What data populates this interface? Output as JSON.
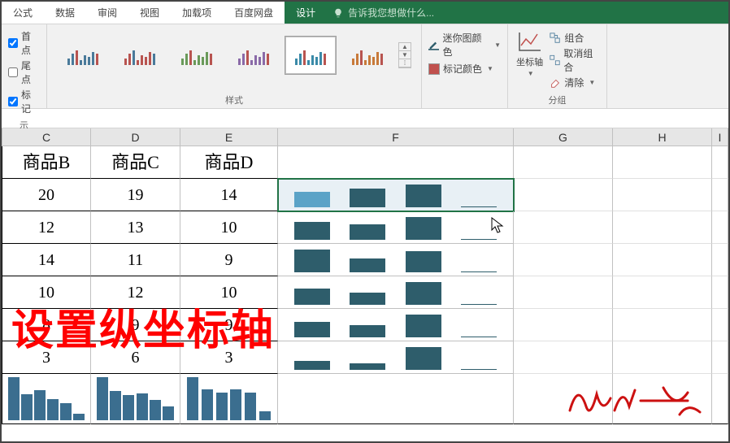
{
  "ribbon": {
    "tabs": [
      "公式",
      "数据",
      "审阅",
      "视图",
      "加载项",
      "百度网盘",
      "设计"
    ],
    "active_tab": "设计",
    "tell_me": "告诉我您想做什么...",
    "show": {
      "first": "首点",
      "last": "尾点",
      "markers": "标记",
      "first_checked": true,
      "last_checked": false,
      "markers_checked": true
    },
    "style_group_label": "样式",
    "color": {
      "sparkline": "迷你图颜色",
      "marker": "标记颜色"
    },
    "axis_label": "坐标轴",
    "group": {
      "group": "组合",
      "ungroup": "取消组合",
      "clear": "清除",
      "group_label": "分组"
    }
  },
  "columns": [
    "C",
    "D",
    "E",
    "F",
    "G",
    "H",
    "I"
  ],
  "header_row": {
    "C": "商品B",
    "D": "商品C",
    "E": "商品D",
    "F": "",
    "G": "",
    "H": "",
    "I": ""
  },
  "rows": [
    {
      "C": "20",
      "D": "19",
      "E": "14"
    },
    {
      "C": "12",
      "D": "13",
      "E": "10"
    },
    {
      "C": "14",
      "D": "11",
      "E": "9"
    },
    {
      "C": "10",
      "D": "12",
      "E": "10"
    },
    {
      "C": "8",
      "D": "9",
      "E": "9"
    },
    {
      "C": "3",
      "D": "6",
      "E": "3"
    }
  ],
  "chart_data": {
    "type": "bar",
    "note": "Column F contains win/loss style sparklines per row; row 8 (C-E) contains column sparklines summarizing each column's 6 values above.",
    "row_sparklines": [
      {
        "row": 2,
        "values": [
          20,
          19,
          14
        ],
        "highlighted_first": true
      },
      {
        "row": 3,
        "values": [
          12,
          13,
          10
        ]
      },
      {
        "row": 4,
        "values": [
          14,
          11,
          9
        ]
      },
      {
        "row": 5,
        "values": [
          10,
          12,
          10
        ]
      },
      {
        "row": 6,
        "values": [
          8,
          9,
          9
        ]
      },
      {
        "row": 7,
        "values": [
          3,
          6,
          3
        ]
      }
    ],
    "column_sparklines": {
      "C": [
        20,
        12,
        14,
        10,
        8,
        3
      ],
      "D": [
        19,
        13,
        11,
        12,
        9,
        6
      ],
      "E": [
        14,
        10,
        9,
        10,
        9,
        3
      ]
    }
  },
  "overlay_text": "设置纵坐标轴",
  "colors": {
    "accent": "#217346",
    "spark_bar": "#2e5d6b",
    "spark_first": "#5ba3c7",
    "overlay": "#ff0000"
  }
}
